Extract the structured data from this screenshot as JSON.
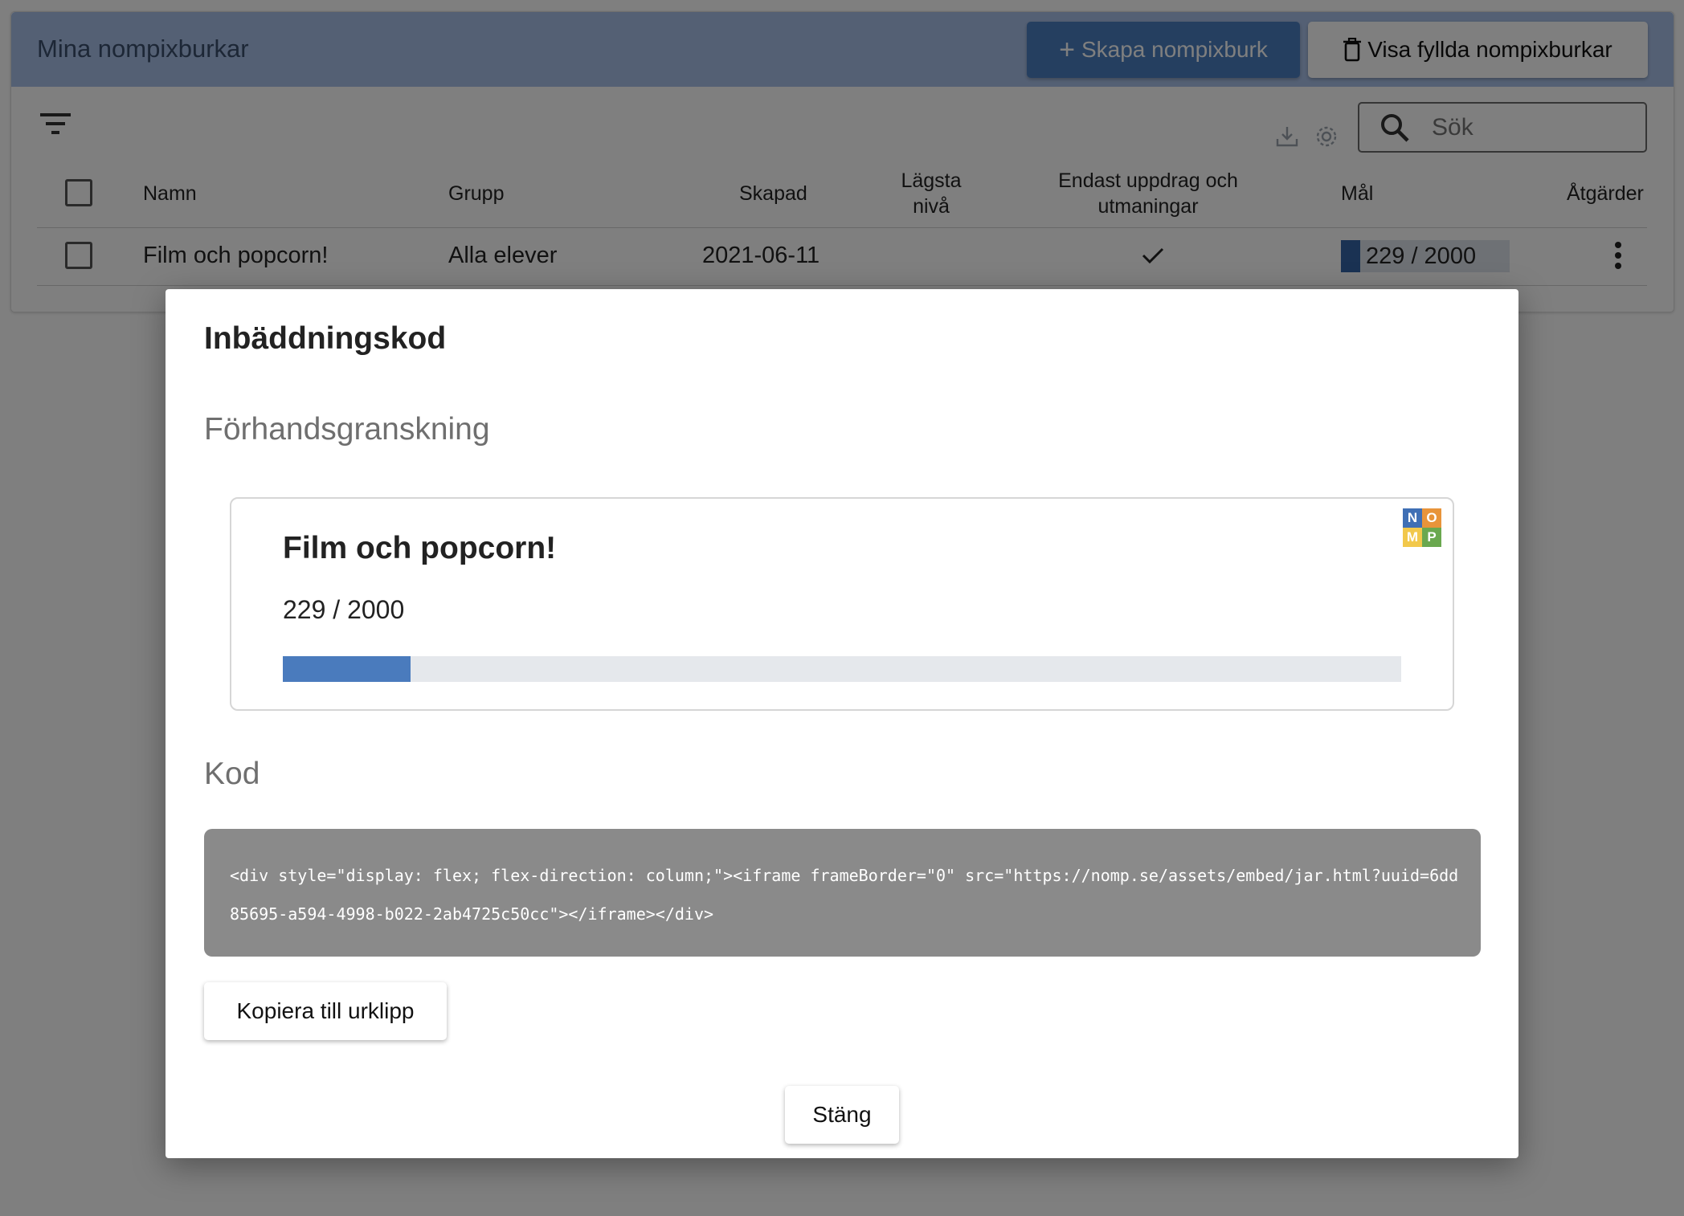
{
  "header": {
    "title": "Mina nompixburkar",
    "create_button": "Skapa nompixburk",
    "show_filled_button": "Visa fyllda nompixburkar"
  },
  "toolbar": {
    "search_placeholder": "Sök",
    "icons": [
      "filter-icon",
      "download-icon",
      "settings-icon",
      "search-icon"
    ]
  },
  "table": {
    "columns": {
      "name": "Namn",
      "group": "Grupp",
      "created": "Skapad",
      "lowest_level_1": "Lägsta",
      "lowest_level_2": "nivå",
      "missions_only_1": "Endast uppdrag och",
      "missions_only_2": "utmaningar",
      "goal": "Mål",
      "actions": "Åtgärder"
    },
    "rows": [
      {
        "name": "Film och popcorn!",
        "group": "Alla elever",
        "created": "2021-06-11",
        "lowest_level": "",
        "missions_only": "✓",
        "goal_text": "229 / 2000",
        "goal_fraction": 0.1145
      }
    ]
  },
  "modal": {
    "title": "Inbäddningskod",
    "preview_heading": "Förhandsgranskning",
    "preview": {
      "title": "Film och popcorn!",
      "count": "229 / 2000",
      "progress_fraction": 0.1145,
      "logo_letters": [
        "N",
        "O",
        "M",
        "P"
      ],
      "logo_colors": [
        "#3f6fb5",
        "#e8943a",
        "#f2c84b",
        "#6aa84f"
      ]
    },
    "code_heading": "Kod",
    "code": "<div style=\"display: flex; flex-direction: column;\"><iframe frameBorder=\"0\" src=\"https://nomp.se/assets/embed/jar.html?uuid=6dd85695-a594-4998-b022-2ab4725c50cc\"></iframe></div>",
    "copy_button": "Kopiera till urklipp",
    "close_button": "Stäng"
  },
  "colors": {
    "header_bg": "#a9c1e9",
    "primary": "#4a7fc1",
    "progress": "#4a7bbd",
    "overlay": "rgba(0,0,0,0.5)"
  }
}
